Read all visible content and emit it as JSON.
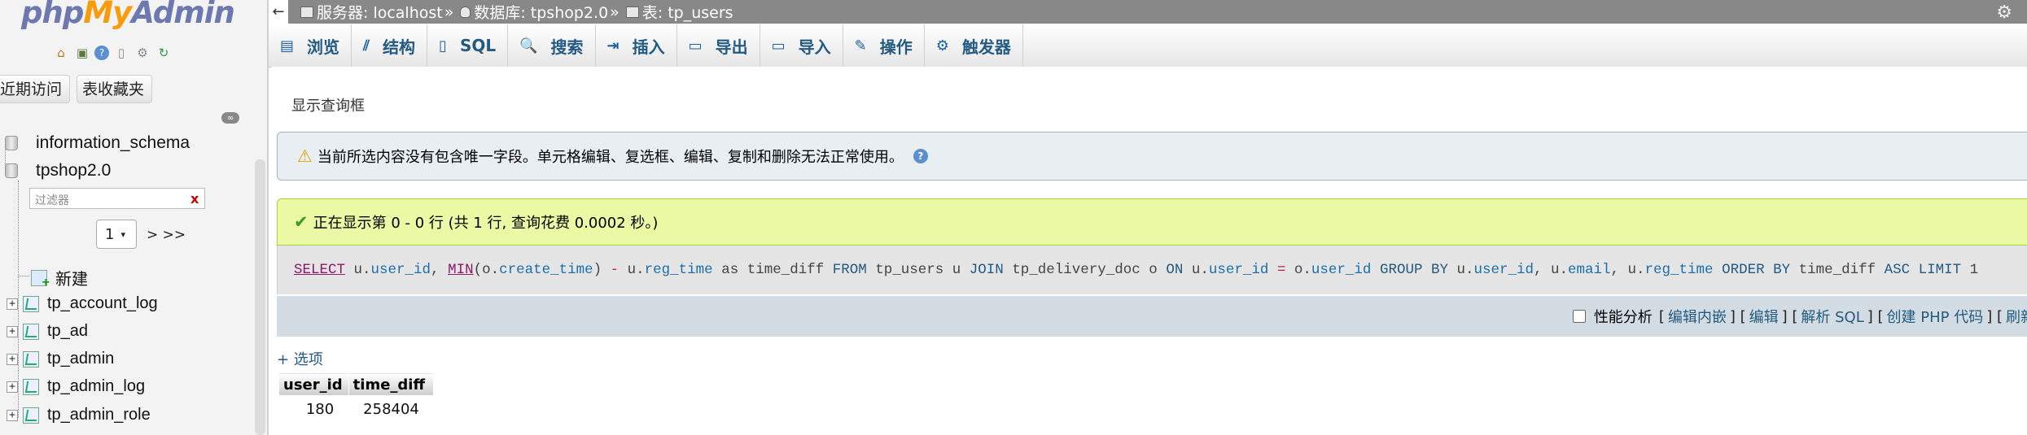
{
  "nav": {
    "logo": {
      "php": "php",
      "my": "My",
      "admin": "Admin"
    },
    "icons": [
      "home-icon",
      "exit-icon",
      "help-icon",
      "docs-icon",
      "settings-gear-icon",
      "reload-icon"
    ],
    "tabs": [
      "近期访问",
      "表收藏夹"
    ],
    "databases": [
      "information_schema",
      "tpshop2.0"
    ],
    "filter_placeholder": "过滤器",
    "filter_clear": "x",
    "page_select": "1",
    "page_next": "> >>",
    "new_label": "新建",
    "tables": [
      "tp_account_log",
      "tp_ad",
      "tp_admin",
      "tp_admin_log",
      "tp_admin_role"
    ]
  },
  "breadcrumb": {
    "server": "服务器: localhost",
    "database": "数据库: tpshop2.0",
    "table": "表: tp_users",
    "sep": "»"
  },
  "menu": [
    {
      "icon": "browse-icon",
      "glyph": "▤",
      "label": "浏览"
    },
    {
      "icon": "structure-icon",
      "glyph": "⫽",
      "label": "结构"
    },
    {
      "icon": "sql-icon",
      "glyph": "▯",
      "label": "SQL"
    },
    {
      "icon": "search-icon",
      "glyph": "🔍",
      "label": "搜索"
    },
    {
      "icon": "insert-icon",
      "glyph": "⇥",
      "label": "插入"
    },
    {
      "icon": "export-icon",
      "glyph": "▭",
      "label": "导出"
    },
    {
      "icon": "import-icon",
      "glyph": "▭",
      "label": "导入"
    },
    {
      "icon": "operations-icon",
      "glyph": "✎",
      "label": "操作"
    },
    {
      "icon": "triggers-icon",
      "glyph": "⚙",
      "label": "触发器"
    }
  ],
  "query_box_toggle": "显示查询框",
  "notice": "当前所选内容没有包含唯一字段。单元格编辑、复选框、编辑、复制和删除无法正常使用。",
  "success": "正在显示第 0 - 0 行 (共 1 行, 查询花费 0.0002 秒。)",
  "sql": {
    "tokens": [
      [
        "kw-u",
        "SELECT"
      ],
      [
        "",
        " u."
      ],
      [
        "fld",
        "user_id"
      ],
      [
        "",
        ", "
      ],
      [
        "kw-u",
        "MIN"
      ],
      [
        "",
        "(o."
      ],
      [
        "fld",
        "create_time"
      ],
      [
        "",
        ") "
      ],
      [
        "op",
        "-"
      ],
      [
        "",
        " u."
      ],
      [
        "fld",
        "reg_time"
      ],
      [
        "",
        " as time_diff "
      ],
      [
        "kw",
        "FROM"
      ],
      [
        "",
        " tp_users u "
      ],
      [
        "kw",
        "JOIN"
      ],
      [
        "",
        " tp_delivery_doc o "
      ],
      [
        "kw",
        "ON"
      ],
      [
        "",
        " u."
      ],
      [
        "fld",
        "user_id"
      ],
      [
        "",
        " "
      ],
      [
        "op",
        "="
      ],
      [
        "",
        " o."
      ],
      [
        "fld",
        "user_id"
      ],
      [
        "",
        " "
      ],
      [
        "kw",
        "GROUP BY"
      ],
      [
        "",
        " u."
      ],
      [
        "fld",
        "user_id"
      ],
      [
        "",
        ", u."
      ],
      [
        "fld",
        "email"
      ],
      [
        "",
        ", u."
      ],
      [
        "fld",
        "reg_time"
      ],
      [
        "",
        " "
      ],
      [
        "kw",
        "ORDER BY"
      ],
      [
        "",
        " time_diff "
      ],
      [
        "kw",
        "ASC"
      ],
      [
        "",
        " "
      ],
      [
        "kw",
        "LIMIT"
      ],
      [
        "",
        " 1"
      ]
    ]
  },
  "actions": {
    "profiling": "性能分析",
    "links": [
      "编辑内嵌",
      "编辑",
      "解析 SQL",
      "创建 PHP 代码",
      "刷新"
    ]
  },
  "options_link": "+ 选项",
  "results": {
    "columns": [
      "user_id",
      "time_diff"
    ],
    "rows": [
      [
        "180",
        "258404"
      ]
    ]
  }
}
